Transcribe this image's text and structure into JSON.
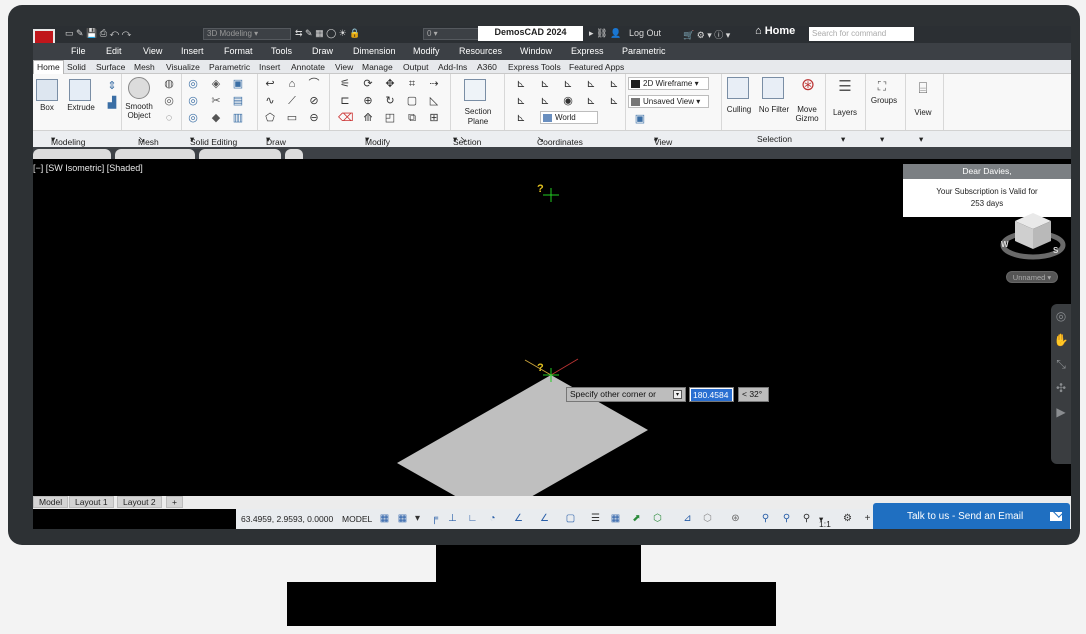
{
  "app": {
    "title": "DemosCAD 2024",
    "workspace": "3D Modeling",
    "layer": "0",
    "user": "Log Out",
    "home": "Home",
    "search_placeholder": "Search for command"
  },
  "menu": [
    "File",
    "Edit",
    "View",
    "Insert",
    "Format",
    "Tools",
    "Draw",
    "Dimension",
    "Modify",
    "Resources",
    "Window",
    "Express",
    "Parametric"
  ],
  "ribbon_tabs": [
    "Home",
    "Solid",
    "Surface",
    "Mesh",
    "Visualize",
    "Parametric",
    "Insert",
    "Annotate",
    "View",
    "Manage",
    "Output",
    "Add-Ins",
    "A360",
    "Express Tools",
    "Featured Apps"
  ],
  "ribbon": {
    "box": "Box",
    "extrude": "Extrude",
    "smooth": "Smooth",
    "object": "Object",
    "section_plane_1": "Section",
    "section_plane_2": "Plane",
    "visual_style": "2D Wireframe",
    "view_name": "Unsaved View",
    "ucs": "World",
    "culling": "Culling",
    "no_filter": "No Filter",
    "move": "Move",
    "gizmo": "Gizmo",
    "layers": "Layers",
    "groups": "Groups",
    "view": "View"
  },
  "panels": [
    "Modeling",
    "Mesh",
    "Solid Editing",
    "Draw",
    "Modify",
    "Section",
    "Coordinates",
    "View",
    "Selection"
  ],
  "viewport": {
    "label": "[−] [SW Isometric] [Shaded]",
    "prompt": "Specify other corner or",
    "distance": "180.4584",
    "angle": "< 32°",
    "named_view": "Unnamed"
  },
  "notice": {
    "header": "Dear Davies,",
    "line1": "Your Subscription is Valid for",
    "line2": "253 days"
  },
  "layout_tabs": [
    "Model",
    "Layout 1",
    "Layout 2",
    "+"
  ],
  "status": {
    "coords": "63.4959, 2.9593, 0.0000",
    "space": "MODEL",
    "scale": "1:1"
  },
  "chat": {
    "label": "Talk to us - Send an Email"
  }
}
